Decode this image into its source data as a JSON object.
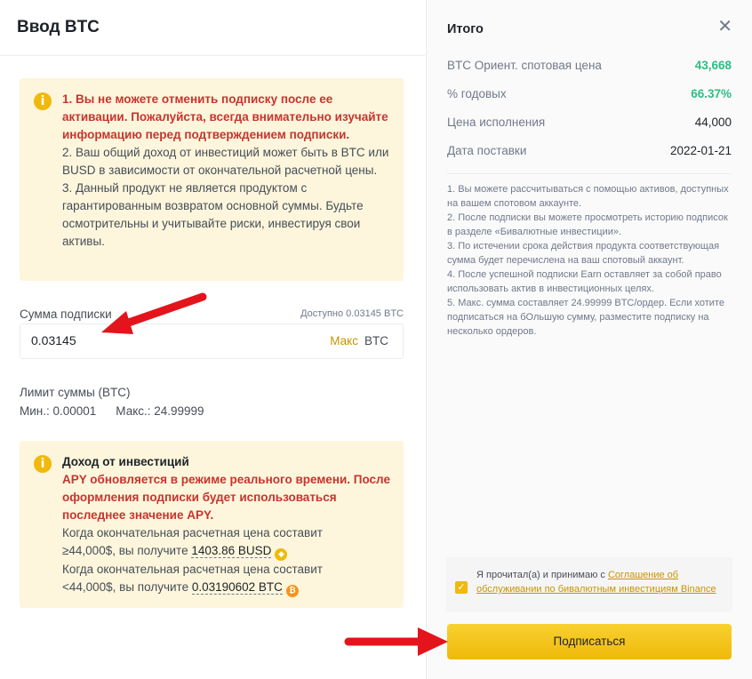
{
  "left": {
    "title": "Ввод BTC",
    "notice1": {
      "icon": "info-icon",
      "line1": "1. Вы не можете отменить подписку после ее активации. Пожалуйста, всегда внимательно изучайте информацию перед подтверждением подписки.",
      "line2": "2. Ваш общий доход от инвестиций может быть в BTC или BUSD в зависимости от окончательной расчетной цены.",
      "line3": "3. Данный продукт не является продуктом с гарантированным возвратом основной суммы. Будьте осмотрительны и учитывайте риски, инвестируя свои активы."
    },
    "subscription": {
      "label": "Сумма подписки",
      "available": "Доступно 0.03145 BTC",
      "value": "0.03145",
      "max_label": "Макс",
      "unit": "BTC"
    },
    "limit": {
      "label": "Лимит суммы (BTC)",
      "min": "Мин.: 0.00001",
      "max": "Макс.: 24.99999"
    },
    "notice2": {
      "icon": "info-icon",
      "heading": "Доход от инвестиций",
      "warning": "APY обновляется в режиме реального времени. После оформления подписки будет использоваться последнее значение APY.",
      "cond1": "Когда окончательная расчетная цена составит",
      "cond1_prefix": "≥44,000$, вы получите",
      "cond1_amount": "1403.86 BUSD",
      "cond2": "Когда окончательная расчетная цена составит",
      "cond2_prefix": "<44,000$, вы получите",
      "cond2_amount": "0.03190602 BTC"
    }
  },
  "right": {
    "title": "Итого",
    "close_icon": "close-icon",
    "rows": [
      {
        "label": "BTC Ориент. спотовая цена",
        "value": "43,668"
      },
      {
        "label": "% годовых",
        "value": "66.37%"
      },
      {
        "label": "Цена исполнения",
        "value": "44,000"
      },
      {
        "label": "Дата поставки",
        "value": "2022-01-21"
      }
    ],
    "terms": [
      "1. Вы можете рассчитываться с помощью активов, доступных на вашем спотовом аккаунте.",
      "2. После подписки вы можете просмотреть историю подписок в разделе «Бивалютные инвестиции».",
      "3. По истечении срока действия продукта соответствующая сумма будет перечислена на ваш спотовый аккаунт.",
      "4. После успешной подписки Earn оставляет за собой право использовать актив в инвестиционных целях.",
      "5. Макс. сумма составляет 24.99999 BTC/ордер. Если хотите подписаться на бОльшую сумму, разместите подписку на несколько ордеров."
    ],
    "agree_prefix": "Я прочитал(а) и принимаю с ",
    "agree_link": "Соглашение об обслуживании по бивалютным инвестициям Binance",
    "subscribe_label": "Подписаться"
  },
  "colors": {
    "accent": "#f0b90b",
    "warning_red": "#c8342e",
    "positive_green": "#2ebd85",
    "arrow_red": "#e3141b"
  }
}
